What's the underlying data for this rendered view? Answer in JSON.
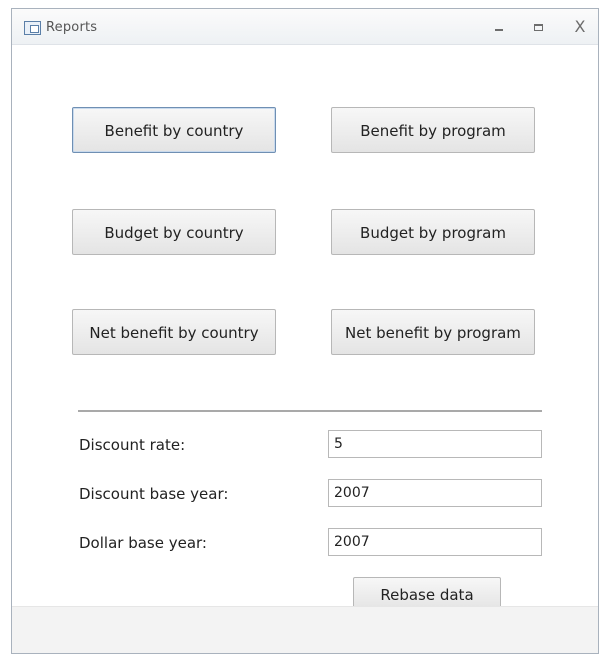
{
  "window": {
    "title": "Reports",
    "controls": {
      "minimize": "minimize",
      "maximize": "maximize",
      "close": "X"
    }
  },
  "buttons": {
    "benefit_by_country": "Benefit by country",
    "benefit_by_program": "Benefit by program",
    "budget_by_country": "Budget by country",
    "budget_by_program": "Budget by program",
    "net_benefit_by_country": "Net benefit by country",
    "net_benefit_by_program": "Net benefit by program",
    "rebase_data": "Rebase data"
  },
  "fields": {
    "discount_rate": {
      "label": "Discount rate:",
      "value": "5"
    },
    "discount_base_year": {
      "label": "Discount base year:",
      "value": "2007"
    },
    "dollar_base_year": {
      "label": "Dollar base year:",
      "value": "2007"
    }
  },
  "icons": {
    "app": "report-window-icon",
    "minimize": "minimize-icon",
    "maximize": "maximize-icon",
    "close": "close-icon"
  },
  "colors": {
    "focus_border": "#6f8fb3",
    "button_top": "#f7f7f7",
    "button_bottom": "#e4e4e4",
    "footer": "#f3f3f3"
  }
}
